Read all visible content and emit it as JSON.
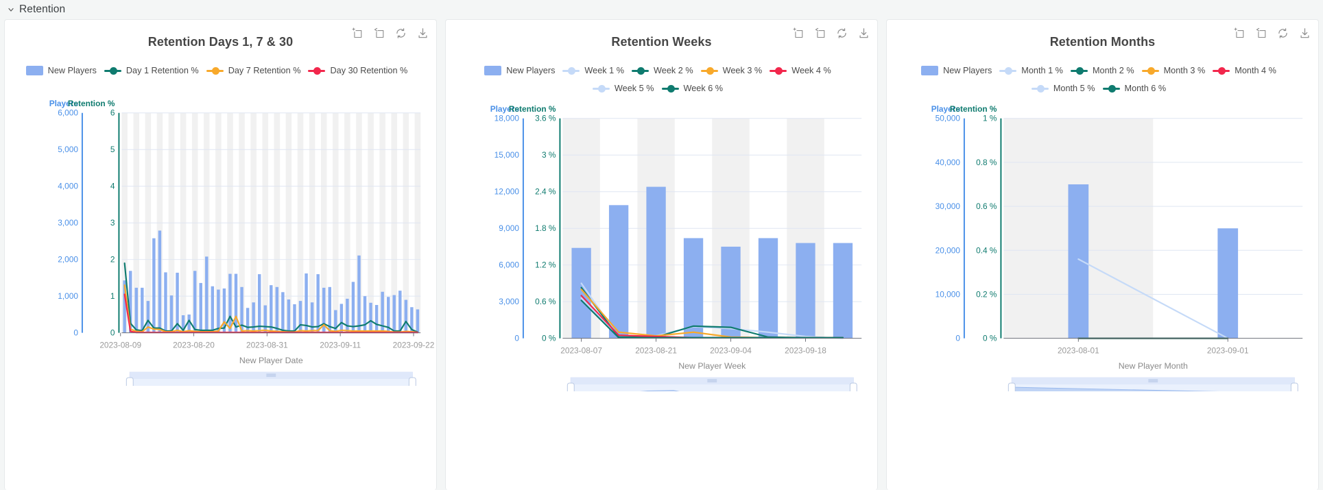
{
  "section": {
    "title": "Retention",
    "collapse_icon": "chevron-down-icon",
    "expanded": true
  },
  "toolbar": {
    "icons": [
      {
        "name": "zoom-area-select-icon",
        "title": "Area zoom"
      },
      {
        "name": "zoom-area-restore-icon",
        "title": "Restore zoom"
      },
      {
        "name": "refresh-icon",
        "title": "Refresh"
      },
      {
        "name": "download-icon",
        "title": "Save as image"
      }
    ]
  },
  "colors": {
    "bar_blue": "#8caff0",
    "line_teal": "#0f7b6f",
    "line_orange": "#f8a92b",
    "line_red": "#f2274c",
    "line_lightblue": "#c5daf8",
    "line_paleblue": "#a7c6f5",
    "axis_blue": "#4a90e8",
    "axis_teal": "#0f7b6f",
    "axis_gray": "#9a9a9a",
    "band_gray": "#eeeeee",
    "panel_bg": "#ffffff",
    "page_bg": "#f4f6f6"
  },
  "panels": [
    {
      "id": "retention-days",
      "title": "Retention Days 1, 7 & 30",
      "legend": [
        {
          "label": "New Players",
          "type": "bar",
          "color": "#8caff0"
        },
        {
          "label": "Day 1 Retention %",
          "type": "line",
          "color": "#0f7b6f"
        },
        {
          "label": "Day 7 Retention %",
          "type": "line",
          "color": "#f8a92b"
        },
        {
          "label": "Day 30 Retention %",
          "type": "line",
          "color": "#f2274c"
        }
      ],
      "chart_data": {
        "type": "bar",
        "title": "Retention Days 1, 7 & 30",
        "xlabel": "New Player Date",
        "grid": true,
        "legend_position": "top",
        "axes": {
          "left": {
            "name": "Players",
            "color": "#4a90e8",
            "ticks": [
              "0",
              "1,000",
              "2,000",
              "3,000",
              "4,000",
              "5,000",
              "6,000"
            ],
            "min": 0,
            "max": 6000
          },
          "right": {
            "name": "Retention %",
            "color": "#0f7b6f",
            "ticks": [
              "0",
              "1",
              "2",
              "3",
              "4",
              "5",
              "6"
            ],
            "min": 0,
            "max": 6
          },
          "x": {
            "tick_labels": [
              "2023-08-09",
              "2023-08-20",
              "2023-08-31",
              "2023-09-11",
              "2023-09-22"
            ]
          }
        },
        "categories": [
          "2023-08-06",
          "2023-08-07",
          "2023-08-08",
          "2023-08-09",
          "2023-08-10",
          "2023-08-11",
          "2023-08-12",
          "2023-08-13",
          "2023-08-14",
          "2023-08-15",
          "2023-08-16",
          "2023-08-17",
          "2023-08-18",
          "2023-08-19",
          "2023-08-20",
          "2023-08-21",
          "2023-08-22",
          "2023-08-23",
          "2023-08-24",
          "2023-08-25",
          "2023-08-26",
          "2023-08-27",
          "2023-08-28",
          "2023-08-29",
          "2023-08-30",
          "2023-08-31",
          "2023-09-01",
          "2023-09-02",
          "2023-09-03",
          "2023-09-04",
          "2023-09-05",
          "2023-09-06",
          "2023-09-07",
          "2023-09-08",
          "2023-09-09",
          "2023-09-10",
          "2023-09-11",
          "2023-09-12",
          "2023-09-13",
          "2023-09-14",
          "2023-09-15",
          "2023-09-16",
          "2023-09-17",
          "2023-09-18",
          "2023-09-19",
          "2023-09-20",
          "2023-09-21",
          "2023-09-22",
          "2023-09-23",
          "2023-09-24",
          "2023-09-25"
        ],
        "series": [
          {
            "name": "New Players",
            "type": "bar",
            "axis": "left",
            "color": "#8caff0",
            "values": [
              1430,
              1690,
              1230,
              1230,
              870,
              2580,
              2790,
              1650,
              1020,
              1640,
              480,
              500,
              1690,
              1360,
              2080,
              1270,
              1180,
              1210,
              1610,
              1610,
              1250,
              680,
              830,
              1600,
              750,
              1300,
              1250,
              1110,
              910,
              780,
              870,
              1620,
              830,
              1600,
              1230,
              1250,
              620,
              790,
              930,
              1390,
              2110,
              1000,
              820,
              760,
              1120,
              980,
              1030,
              1150,
              900,
              700,
              640
            ]
          },
          {
            "name": "Day 1 Retention %",
            "type": "line",
            "axis": "right",
            "color": "#0f7b6f",
            "values": [
              1.9,
              0.26,
              0.08,
              0.06,
              0.34,
              0.13,
              0.13,
              0.05,
              0.05,
              0.25,
              0.07,
              0.34,
              0.09,
              0.07,
              0.07,
              0.07,
              0.12,
              0.13,
              0.45,
              0.16,
              0.21,
              0.15,
              0.16,
              0.18,
              0.17,
              0.16,
              0.12,
              0.07,
              0.05,
              0.05,
              0.22,
              0.2,
              0.16,
              0.17,
              0.25,
              0.17,
              0.12,
              0.28,
              0.19,
              0.17,
              0.19,
              0.22,
              0.33,
              0.23,
              0.19,
              0.15,
              0.05,
              0.05,
              0.31,
              0.09,
              0.02
            ]
          },
          {
            "name": "Day 7 Retention %",
            "type": "line",
            "axis": "right",
            "color": "#f8a92b",
            "values": [
              1.3,
              0.1,
              0.04,
              0.03,
              0.16,
              0.1,
              0.09,
              0.03,
              0.03,
              0.07,
              0.03,
              0.06,
              0.04,
              0.03,
              0.03,
              0.03,
              0.05,
              0.3,
              0.12,
              0.45,
              0.05,
              0.06,
              0.05,
              0.06,
              0.07,
              0.05,
              0.04,
              0.03,
              0.02,
              0.02,
              0.06,
              0.05,
              0.06,
              0.06,
              0.22,
              0.06,
              0.04,
              0.07,
              0.06,
              0.05,
              0.05,
              0.05,
              0.05,
              0.05,
              0.05,
              0.04,
              0.02,
              0.02,
              0.04,
              0.03,
              0.01
            ]
          },
          {
            "name": "Day 30 Retention %",
            "type": "line",
            "axis": "right",
            "color": "#f2274c",
            "values": [
              1.05,
              0.04,
              0.01,
              0.01,
              0.01,
              0.01,
              0.01,
              0.01,
              0.01,
              0.01,
              0.01,
              0.01,
              0.01,
              0.01,
              0.01,
              0.01,
              0.01,
              0.01,
              0.01,
              0.01,
              0.01,
              0.01,
              0.01,
              0.01,
              0.01,
              0.01,
              0.01,
              0.01,
              0.01,
              0.01,
              0.01,
              0.01,
              0.01,
              0.01,
              0.01,
              0.01,
              0.01,
              0.01,
              0.01,
              0.01,
              0.01,
              0.01,
              0.01,
              0.01,
              0.01,
              0.01,
              0.01,
              0.01,
              0.01,
              0.01,
              0.01
            ]
          }
        ],
        "datazoom": {
          "preview_values": [
            0.3,
            0.33,
            0.31,
            0.3,
            0.28,
            0.3,
            0.5,
            0.62,
            0.45,
            0.33,
            0.42,
            0.3,
            0.22,
            0.3,
            0.4,
            0.45,
            0.55,
            0.66,
            0.5,
            0.4,
            0.38,
            0.42,
            0.4,
            0.3,
            0.24,
            0.4,
            0.33,
            0.3,
            0.3,
            0.32,
            0.32,
            0.3,
            0.28,
            0.26,
            0.3,
            0.46,
            0.36,
            0.48,
            0.42,
            0.33,
            0.28,
            0.26,
            0.25,
            0.3,
            0.42,
            0.58,
            0.5,
            0.3,
            0.24,
            0.22
          ],
          "start_pct": 0,
          "end_pct": 100
        }
      }
    },
    {
      "id": "retention-weeks",
      "title": "Retention Weeks",
      "legend": [
        {
          "label": "New Players",
          "type": "bar",
          "color": "#8caff0"
        },
        {
          "label": "Week 1 %",
          "type": "line",
          "color": "#c5daf8"
        },
        {
          "label": "Week 2 %",
          "type": "line",
          "color": "#0f7b6f"
        },
        {
          "label": "Week 3 %",
          "type": "line",
          "color": "#f8a92b"
        },
        {
          "label": "Week 4 %",
          "type": "line",
          "color": "#f2274c"
        },
        {
          "label": "Week 5 %",
          "type": "line",
          "color": "#c5daf8"
        },
        {
          "label": "Week 6 %",
          "type": "line",
          "color": "#0f7b6f"
        }
      ],
      "chart_data": {
        "type": "bar",
        "title": "Retention Weeks",
        "xlabel": "New Player Week",
        "grid": true,
        "legend_position": "top",
        "axes": {
          "left": {
            "name": "Players",
            "color": "#4a90e8",
            "ticks": [
              "0",
              "3,000",
              "6,000",
              "9,000",
              "12,000",
              "15,000",
              "18,000"
            ],
            "min": 0,
            "max": 18000
          },
          "right": {
            "name": "Retention %",
            "color": "#0f7b6f",
            "ticks": [
              "0 %",
              "0.6 %",
              "1.2 %",
              "1.8 %",
              "2.4 %",
              "3 %",
              "3.6 %"
            ],
            "min": 0,
            "max": 3.6
          },
          "x": {
            "tick_labels": [
              "2023-08-07",
              "2023-08-21",
              "2023-09-04",
              "2023-09-18"
            ]
          }
        },
        "categories": [
          "2023-08-07",
          "2023-08-14",
          "2023-08-21",
          "2023-08-28",
          "2023-09-04",
          "2023-09-11",
          "2023-09-18",
          "2023-09-25"
        ],
        "series": [
          {
            "name": "New Players",
            "type": "bar",
            "axis": "left",
            "color": "#8caff0",
            "values": [
              7400,
              10900,
              12400,
              8200,
              7500,
              8200,
              7800,
              7800
            ]
          },
          {
            "name": "Week 1 %",
            "type": "line",
            "axis": "right",
            "color": "#c5daf8",
            "values": [
              0.9,
              0.02,
              0.04,
              0.19,
              0.16,
              0.1,
              0.03,
              0.0
            ]
          },
          {
            "name": "Week 2 %",
            "type": "line",
            "axis": "right",
            "color": "#0f7b6f",
            "values": [
              0.83,
              0.02,
              0.02,
              0.2,
              0.18,
              0.02,
              0.01,
              0.01
            ]
          },
          {
            "name": "Week 3 %",
            "type": "line",
            "axis": "right",
            "color": "#f8a92b",
            "values": [
              0.8,
              0.1,
              0.04,
              0.1,
              0.02,
              0.01,
              0.01,
              0.01
            ]
          },
          {
            "name": "Week 4 %",
            "type": "line",
            "axis": "right",
            "color": "#f2274c",
            "values": [
              0.7,
              0.05,
              0.03,
              0.01,
              0.01,
              0.01,
              0.01,
              0.01
            ]
          },
          {
            "name": "Week 5 %",
            "type": "line",
            "axis": "right",
            "color": "#c5daf8",
            "values": [
              0.66,
              0.02,
              0.02,
              0.01,
              0.01,
              0.01,
              0.01,
              0.01
            ]
          },
          {
            "name": "Week 6 %",
            "type": "line",
            "axis": "right",
            "color": "#0f7b6f",
            "values": [
              0.62,
              0.01,
              0.01,
              0.01,
              0.01,
              0.01,
              0.01,
              0.01
            ]
          }
        ],
        "datazoom": {
          "preview_values": [
            0.05,
            0.3,
            0.62,
            0.72,
            0.74,
            0.52,
            0.28,
            0.2,
            0.18,
            0.22,
            0.3,
            0.3
          ],
          "start_pct": 0,
          "end_pct": 100
        }
      }
    },
    {
      "id": "retention-months",
      "title": "Retention Months",
      "legend": [
        {
          "label": "New Players",
          "type": "bar",
          "color": "#8caff0"
        },
        {
          "label": "Month 1 %",
          "type": "line",
          "color": "#c5daf8"
        },
        {
          "label": "Month 2 %",
          "type": "line",
          "color": "#0f7b6f"
        },
        {
          "label": "Month 3 %",
          "type": "line",
          "color": "#f8a92b"
        },
        {
          "label": "Month 4 %",
          "type": "line",
          "color": "#f2274c"
        },
        {
          "label": "Month 5 %",
          "type": "line",
          "color": "#c5daf8"
        },
        {
          "label": "Month 6 %",
          "type": "line",
          "color": "#0f7b6f"
        }
      ],
      "chart_data": {
        "type": "bar",
        "title": "Retention Months",
        "xlabel": "New Player Month",
        "grid": true,
        "legend_position": "top",
        "axes": {
          "left": {
            "name": "Players",
            "color": "#4a90e8",
            "ticks": [
              "0",
              "10,000",
              "20,000",
              "30,000",
              "40,000",
              "50,000"
            ],
            "min": 0,
            "max": 50000
          },
          "right": {
            "name": "Retention %",
            "color": "#0f7b6f",
            "ticks": [
              "0 %",
              "0.2 %",
              "0.4 %",
              "0.6 %",
              "0.8 %",
              "1 %"
            ],
            "min": 0,
            "max": 1
          },
          "x": {
            "tick_labels": [
              "2023-08-01",
              "2023-09-01"
            ]
          }
        },
        "categories": [
          "2023-08-01",
          "2023-09-01"
        ],
        "series": [
          {
            "name": "New Players",
            "type": "bar",
            "axis": "left",
            "color": "#8caff0",
            "values": [
              35000,
              25000
            ]
          },
          {
            "name": "Month 1 %",
            "type": "line",
            "axis": "right",
            "color": "#c5daf8",
            "values": [
              0.36,
              0.0
            ]
          },
          {
            "name": "Month 2 %",
            "type": "line",
            "axis": "right",
            "color": "#0f7b6f",
            "values": [
              0.0,
              0.0
            ]
          },
          {
            "name": "Month 3 %",
            "type": "line",
            "axis": "right",
            "color": "#f8a92b",
            "values": [
              0.0,
              0.0
            ]
          },
          {
            "name": "Month 4 %",
            "type": "line",
            "axis": "right",
            "color": "#f2274c",
            "values": [
              0.0,
              0.0
            ]
          },
          {
            "name": "Month 5 %",
            "type": "line",
            "axis": "right",
            "color": "#c5daf8",
            "values": [
              0.0,
              0.0
            ]
          },
          {
            "name": "Month 6 %",
            "type": "line",
            "axis": "right",
            "color": "#0f7b6f",
            "values": [
              0.0,
              0.0
            ]
          }
        ],
        "datazoom": {
          "preview_values": [
            0.88,
            0.62
          ],
          "start_pct": 0,
          "end_pct": 100
        }
      }
    }
  ]
}
